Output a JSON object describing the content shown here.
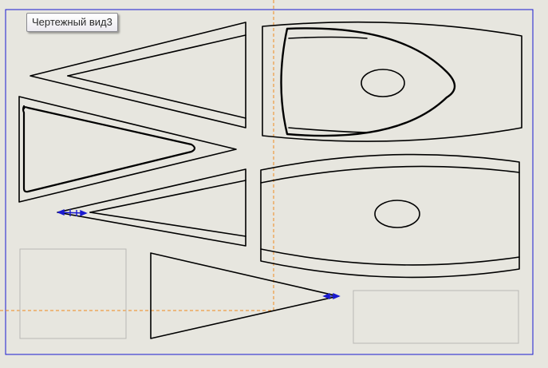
{
  "view": {
    "tooltip_label": "Чертежный вид3"
  },
  "colors": {
    "background": "#e7e6df",
    "sheet_border": "#1a1ad0",
    "guide_line": "#f08a1c",
    "geometry": "#000000",
    "placeholder_frame": "#b8b8b4",
    "dimension_marker": "#1a1ad0"
  }
}
